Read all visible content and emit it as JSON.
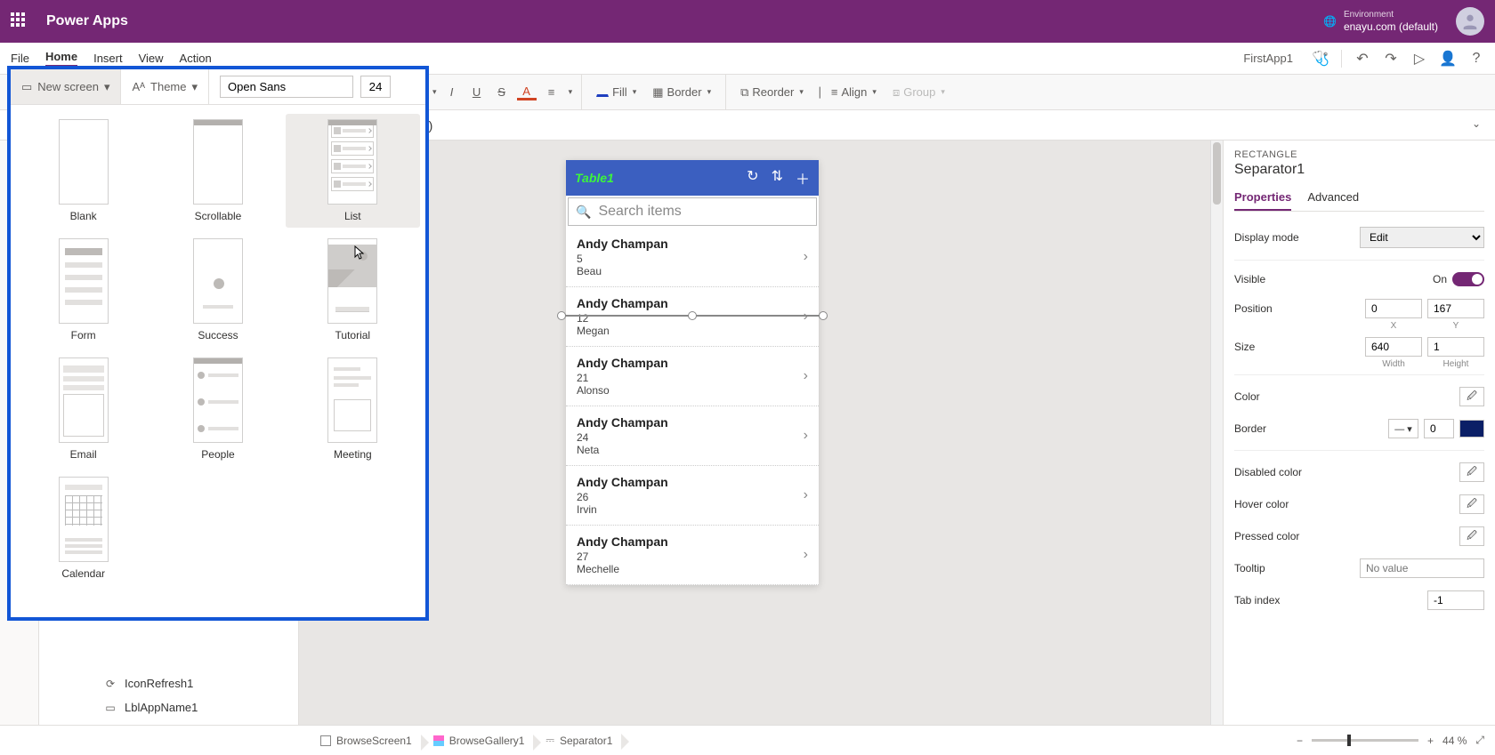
{
  "topbar": {
    "title": "Power Apps",
    "env_label": "Environment",
    "env_value": "enayu.com (default)"
  },
  "menubar": {
    "file": "File",
    "home": "Home",
    "insert": "Insert",
    "view": "View",
    "action": "Action",
    "app_name": "FirstApp1"
  },
  "toolbar": {
    "new_screen": "New screen",
    "theme": "Theme",
    "font": "Open Sans",
    "font_size": "24",
    "fill": "Fill",
    "border": "Border",
    "reorder": "Reorder",
    "align": "Align",
    "group": "Group"
  },
  "popup": {
    "font": "Open Sans",
    "font_size": "24",
    "templates": [
      "Blank",
      "Scrollable",
      "List",
      "Form",
      "Success",
      "Tutorial",
      "Email",
      "People",
      "Meeting",
      "Calendar"
    ]
  },
  "formula_tail": "nt)",
  "tree": {
    "row1": "IconRefresh1",
    "row2": "LblAppName1"
  },
  "phone": {
    "title": "Table1",
    "search_placeholder": "Search items",
    "items": [
      {
        "name": "Andy Champan",
        "num": "5",
        "sub": "Beau"
      },
      {
        "name": "Andy Champan",
        "num": "12",
        "sub": "Megan"
      },
      {
        "name": "Andy Champan",
        "num": "21",
        "sub": "Alonso"
      },
      {
        "name": "Andy Champan",
        "num": "24",
        "sub": "Neta"
      },
      {
        "name": "Andy Champan",
        "num": "26",
        "sub": "Irvin"
      },
      {
        "name": "Andy Champan",
        "num": "27",
        "sub": "Mechelle"
      }
    ]
  },
  "breadcrumbs": {
    "b1": "BrowseScreen1",
    "b2": "BrowseGallery1",
    "b3": "Separator1"
  },
  "zoom": "44 %",
  "props": {
    "type": "RECTANGLE",
    "name": "Separator1",
    "tab_props": "Properties",
    "tab_adv": "Advanced",
    "display_mode_lbl": "Display mode",
    "display_mode_val": "Edit",
    "visible_lbl": "Visible",
    "visible_val": "On",
    "position_lbl": "Position",
    "pos_x": "0",
    "pos_y": "167",
    "x_lbl": "X",
    "y_lbl": "Y",
    "size_lbl": "Size",
    "size_w": "640",
    "size_h": "1",
    "w_lbl": "Width",
    "h_lbl": "Height",
    "color_lbl": "Color",
    "border_lbl": "Border",
    "border_w": "0",
    "disabled_lbl": "Disabled color",
    "hover_lbl": "Hover color",
    "pressed_lbl": "Pressed color",
    "tooltip_lbl": "Tooltip",
    "tooltip_ph": "No value",
    "tabindex_lbl": "Tab index",
    "tabindex_val": "-1"
  }
}
